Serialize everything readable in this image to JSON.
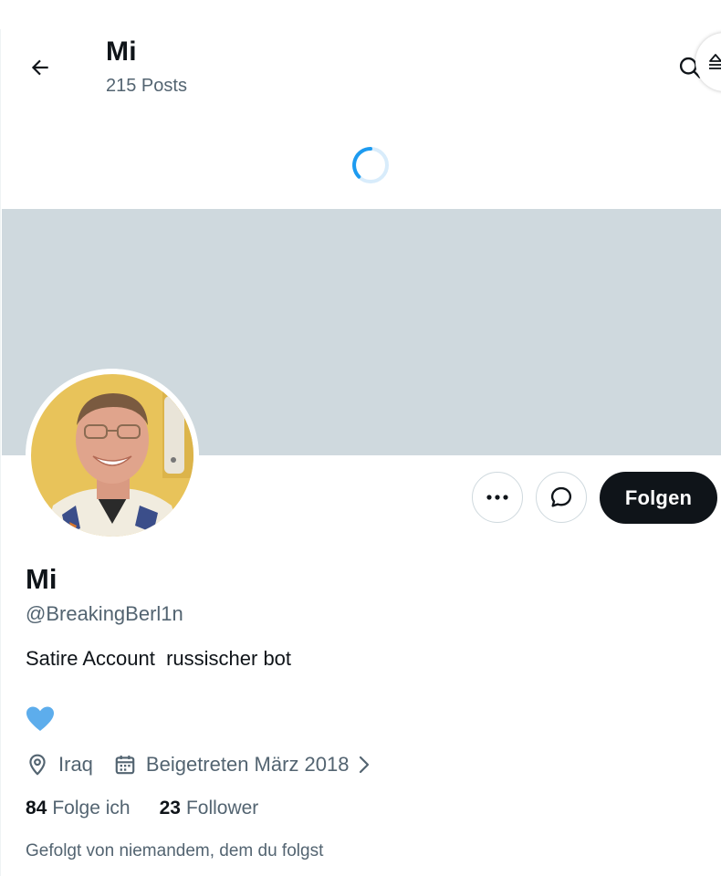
{
  "header": {
    "title": "Mi",
    "posts_count": "215 Posts"
  },
  "profile": {
    "display_name": "Mi",
    "handle": "@BreakingBerl1n",
    "bio": "Satire Account  russischer bot",
    "location": "Iraq",
    "joined": "Beigetreten März 2018",
    "following_count": "84",
    "following_label": "Folge ich",
    "followers_count": "23",
    "followers_label": "Follower",
    "followed_by": "Gefolgt von niemandem, dem du folgst"
  },
  "actions": {
    "follow_label": "Folgen"
  },
  "icons": {
    "back": "arrow-left-icon",
    "search": "search-icon",
    "more": "more-horizontal-icon",
    "message": "message-icon",
    "location": "location-pin-icon",
    "calendar": "calendar-icon",
    "heart": "blue-heart-emoji",
    "chevron": "chevron-right-icon",
    "spinner": "loading-spinner-icon"
  },
  "colors": {
    "banner": "#cfd9de",
    "primary_text": "#0f1419",
    "secondary_text": "#536471",
    "follow_button": "#0f1419",
    "accent": "#1d9bf0",
    "heart": "#5dadec"
  }
}
